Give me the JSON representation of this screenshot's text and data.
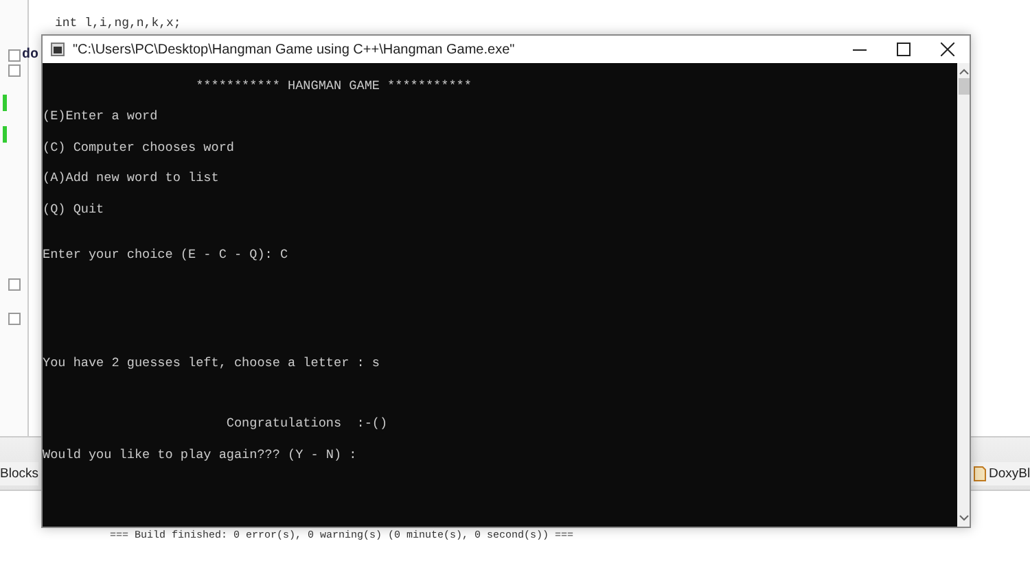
{
  "editor": {
    "code_lines": [
      {
        "text": "int l,i,ng,n,k,x;"
      }
    ],
    "fold_keyword": "do"
  },
  "bottom_tabs": [
    {
      "label": "Blocks"
    },
    {
      "label": "DoxyBl"
    }
  ],
  "build_log": "=== Build finished: 0 error(s), 0 warning(s) (0 minute(s), 0 second(s)) ===",
  "window": {
    "title": "\"C:\\Users\\PC\\Desktop\\Hangman Game using C++\\Hangman Game.exe\""
  },
  "console_lines": [
    {
      "text": "                    *********** HANGMAN GAME ***********"
    },
    {
      "text": "(E)Enter a word"
    },
    {
      "text": "(C) Computer chooses word"
    },
    {
      "text": "(A)Add new word to list"
    },
    {
      "text": "(Q) Quit"
    },
    {
      "text": "Enter your choice (E - C - Q): C"
    },
    {
      "text": "You have 2 guesses left, choose a letter : s"
    },
    {
      "text": "                        Congratulations  :-()"
    },
    {
      "text": "Would you like to play again??? (Y - N) :"
    }
  ]
}
